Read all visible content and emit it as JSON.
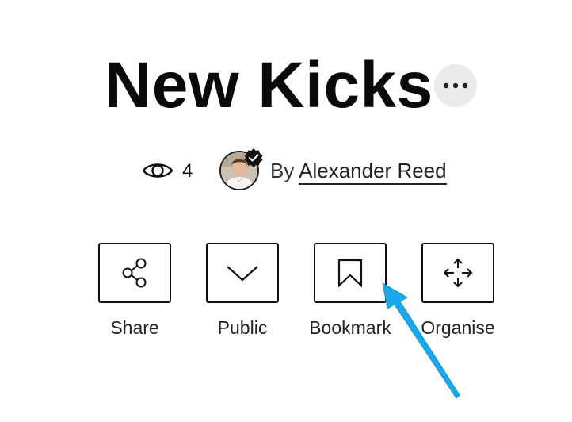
{
  "header": {
    "title": "New Kicks",
    "more_icon": "more-horizontal-icon"
  },
  "meta": {
    "views_icon": "eye-icon",
    "views_count": "4",
    "by_prefix": "By",
    "author_name": "Alexander Reed",
    "verified_icon": "verified-badge-icon"
  },
  "actions": [
    {
      "label": "Share",
      "icon": "share-icon"
    },
    {
      "label": "Public",
      "icon": "chevron-down-icon"
    },
    {
      "label": "Bookmark",
      "icon": "bookmark-icon"
    },
    {
      "label": "Organise",
      "icon": "move-icon"
    }
  ],
  "annotation": {
    "arrow_color": "#1aa8e8",
    "target": "Bookmark"
  }
}
